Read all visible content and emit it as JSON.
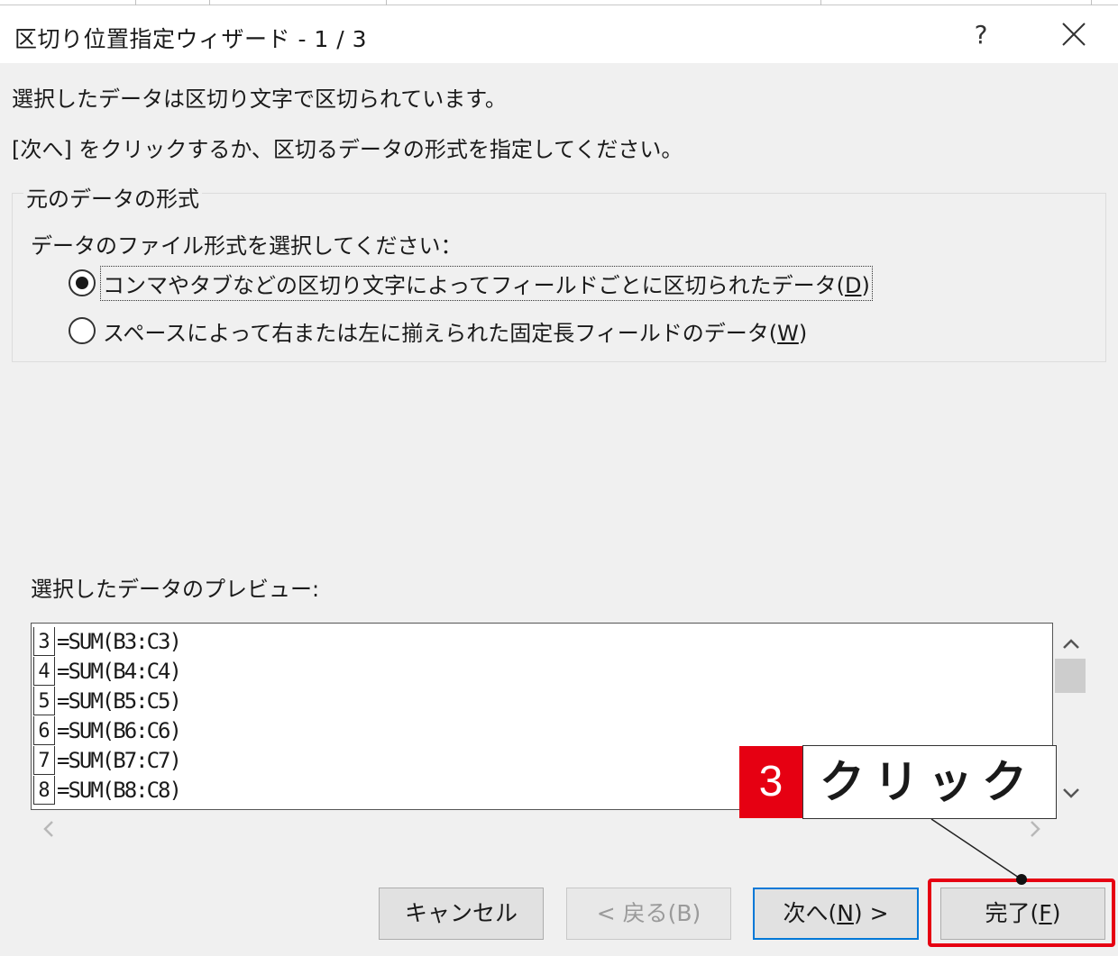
{
  "dialog": {
    "title": "区切り位置指定ウィザード - 1 / 3",
    "help": "?",
    "intro_line1": "選択したデータは区切り文字で区切られています。",
    "intro_line2": "[次へ] をクリックするか、区切るデータの形式を指定してください。"
  },
  "format_group": {
    "title": "元のデータの形式",
    "prompt": "データのファイル形式を選択してください：",
    "options": [
      {
        "label": "コンマやタブなどの区切り文字によってフィールドごとに区切られたデータ(",
        "accel": "D",
        "suffix": ")",
        "selected": true
      },
      {
        "label": "スペースによって右または左に揃えられた固定長フィールドのデータ(",
        "accel": "W",
        "suffix": ")",
        "selected": false
      }
    ]
  },
  "preview": {
    "label": "選択したデータのプレビュー:",
    "rows": [
      {
        "num": "3",
        "value": "=SUM(B3:C3)"
      },
      {
        "num": "4",
        "value": "=SUM(B4:C4)"
      },
      {
        "num": "5",
        "value": "=SUM(B5:C5)"
      },
      {
        "num": "6",
        "value": "=SUM(B6:C6)"
      },
      {
        "num": "7",
        "value": "=SUM(B7:C7)"
      },
      {
        "num": "8",
        "value": "=SUM(B8:C8)"
      }
    ]
  },
  "buttons": {
    "cancel": "キャンセル",
    "back": "< 戻る(B)",
    "next_prefix": "次へ(",
    "next_accel": "N",
    "next_suffix": ") >",
    "finish_prefix": "完了(",
    "finish_accel": "F",
    "finish_suffix": ")"
  },
  "annotation": {
    "step": "3",
    "text": "クリック",
    "color": "#e60012"
  }
}
